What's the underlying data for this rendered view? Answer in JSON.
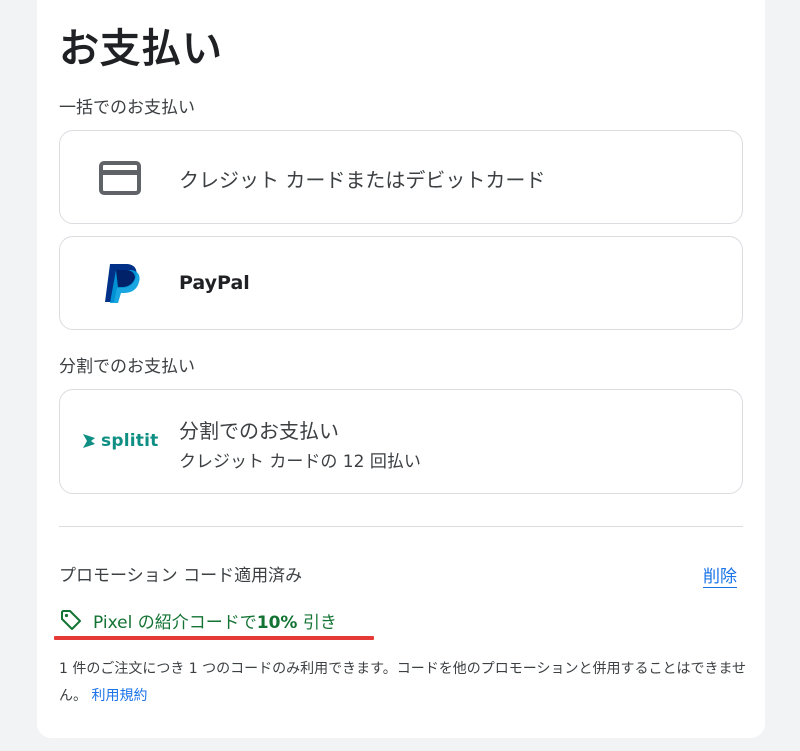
{
  "page": {
    "title": "お支払い",
    "section_onetime": "一括でのお支払い",
    "section_installment": "分割でのお支払い"
  },
  "options": {
    "card": {
      "label": "クレジット カードまたはデビットカード",
      "icon": "credit-card-icon"
    },
    "paypal": {
      "label": "PayPal",
      "icon": "paypal-logo"
    },
    "splitit": {
      "logo_text": "splitit",
      "label": "分割でのお支払い",
      "sublabel": "クレジット カードの 12 回払い"
    }
  },
  "promo": {
    "title": "プロモーション コード適用済み",
    "remove_label": "削除",
    "applied_prefix": "Pixel の紹介コードで",
    "applied_bold": "10%",
    "applied_suffix": " 引き",
    "note": "1 件のご注文につき 1 つのコードのみ利用できます。コードを他のプロモーションと併用することはできません。",
    "terms_link": "利用規約"
  },
  "colors": {
    "accent_blue": "#1a73e8",
    "promo_green": "#137333",
    "highlight_red": "#e53935",
    "paypal_dark": "#003087",
    "paypal_light": "#009cde",
    "splitit_teal": "#0f8f84"
  }
}
